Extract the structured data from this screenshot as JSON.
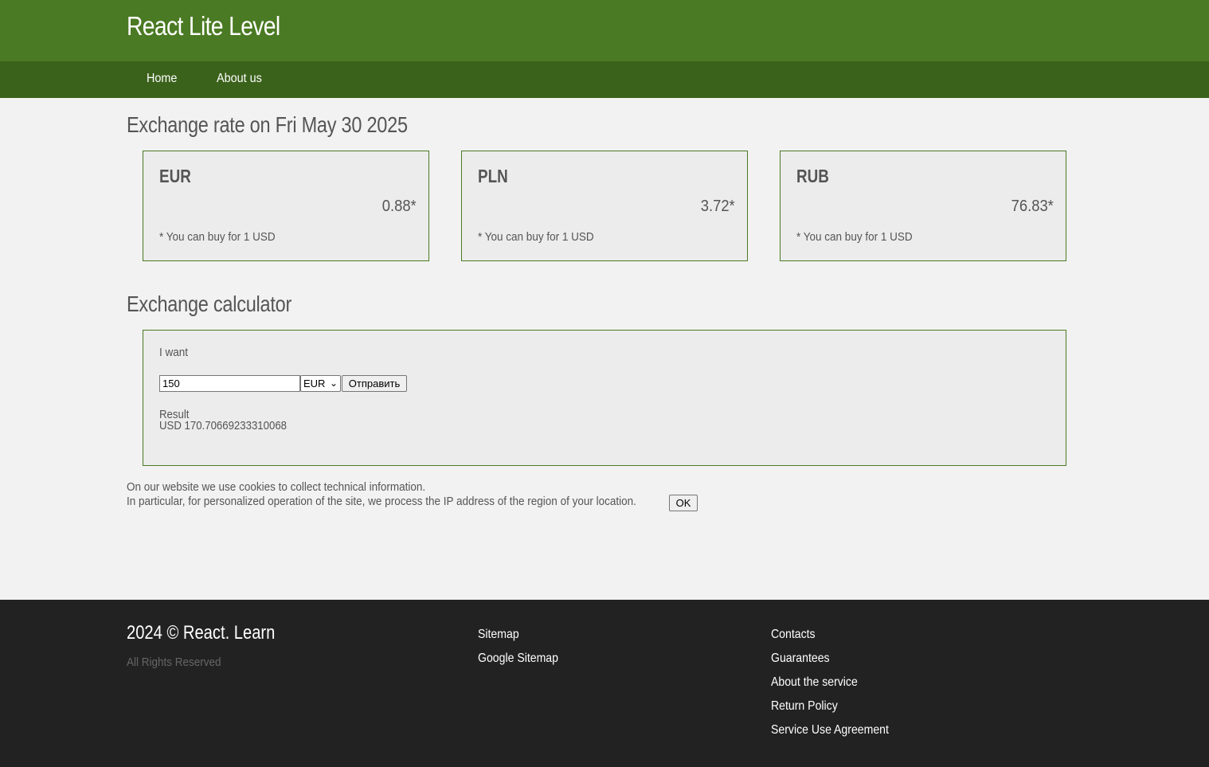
{
  "header": {
    "logo": "React Lite Level"
  },
  "nav": {
    "items": [
      {
        "label": "Home"
      },
      {
        "label": "About us"
      }
    ]
  },
  "rates": {
    "title": "Exchange rate on Fri May 30 2025",
    "cards": [
      {
        "code": "EUR",
        "rate": "0.88*",
        "note": "* You can buy for 1 USD"
      },
      {
        "code": "PLN",
        "rate": "3.72*",
        "note": "* You can buy for 1 USD"
      },
      {
        "code": "RUB",
        "rate": "76.83*",
        "note": "* You can buy for 1 USD"
      }
    ]
  },
  "calculator": {
    "title": "Exchange calculator",
    "want_label": "I want",
    "amount_value": "150",
    "currency_selected": "EUR",
    "submit_label": "Отправить",
    "result_label": "Result",
    "result_value": "USD 170.70669233310068"
  },
  "cookie": {
    "line1": "On our website we use cookies to collect technical information.",
    "line2": "In particular, for personalized operation of the site, we process the IP address of the region of your location.",
    "ok_label": "OK"
  },
  "footer": {
    "copyright": "2024 © React. Learn",
    "rights": "All Rights Reserved",
    "col1": [
      {
        "label": "Sitemap"
      },
      {
        "label": "Google Sitemap"
      }
    ],
    "col2": [
      {
        "label": "Contacts"
      },
      {
        "label": "Guarantees"
      },
      {
        "label": "About the service"
      },
      {
        "label": "Return Policy"
      },
      {
        "label": "Service Use Agreement"
      }
    ]
  },
  "colors": {
    "header": "#4a7a23",
    "nav": "#3b621b",
    "footer": "#222222",
    "background": "#f2f2f2",
    "card_border": "#4a7a23"
  }
}
